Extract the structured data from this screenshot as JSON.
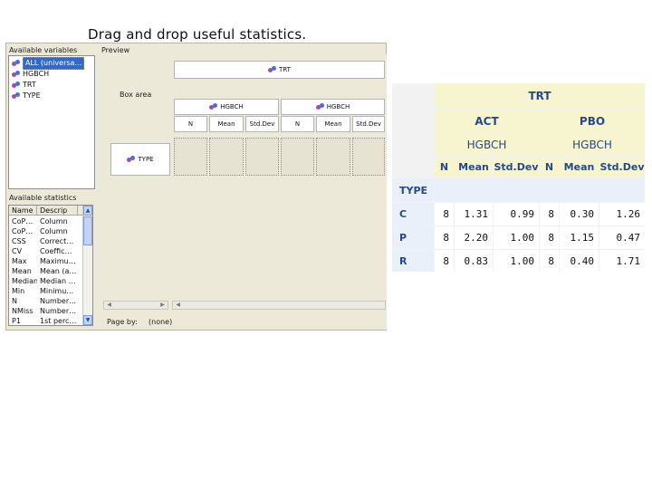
{
  "slide_title": "Drag and drop useful statistics.",
  "dialog": {
    "variables_label": "Available variables",
    "variables": [
      {
        "label": "ALL (universa…",
        "selected": true
      },
      {
        "label": "HGBCH",
        "selected": false
      },
      {
        "label": "TRT",
        "selected": false
      },
      {
        "label": "TYPE",
        "selected": false
      }
    ],
    "statistics_label": "Available statistics",
    "stat_columns": [
      "Name",
      "Descrip"
    ],
    "statistics": [
      {
        "name": "CoP…",
        "desc": "Column"
      },
      {
        "name": "CoP…",
        "desc": "Column"
      },
      {
        "name": "CSS",
        "desc": "Correct…"
      },
      {
        "name": "CV",
        "desc": "Coeffic…"
      },
      {
        "name": "Max",
        "desc": "Maximu…"
      },
      {
        "name": "Mean",
        "desc": "Mean (a…"
      },
      {
        "name": "Median",
        "desc": "Median …"
      },
      {
        "name": "Min",
        "desc": "Minimu…"
      },
      {
        "name": "N",
        "desc": "Number…"
      },
      {
        "name": "NMiss",
        "desc": "Number…"
      },
      {
        "name": "P1",
        "desc": "1st perc…"
      }
    ],
    "preview_label": "Preview",
    "box_area_label": "Box area",
    "trt_label": "TRT",
    "hgbch_label": "HGBCH",
    "stat_labels": [
      "N",
      "Mean",
      "Std.Dev",
      "N",
      "Mean",
      "Std.Dev"
    ],
    "type_label": "TYPE",
    "page_by_label": "Page by:",
    "page_by_value": "(none)"
  },
  "result_table": {
    "top_header": "TRT",
    "groups": [
      "ACT",
      "PBO"
    ],
    "sub_header": "HGBCH",
    "stat_headers": [
      "N",
      "Mean",
      "Std.Dev",
      "N",
      "Mean",
      "Std.Dev"
    ],
    "row_dim": "TYPE",
    "rows": [
      {
        "label": "C",
        "values": [
          "8",
          "1.31",
          "0.99",
          "8",
          "0.30",
          "1.26"
        ]
      },
      {
        "label": "P",
        "values": [
          "8",
          "2.20",
          "1.00",
          "8",
          "1.15",
          "0.47"
        ]
      },
      {
        "label": "R",
        "values": [
          "8",
          "0.83",
          "1.00",
          "8",
          "0.40",
          "1.71"
        ]
      }
    ],
    "colors": {
      "header_bg": "#f7f5cf",
      "header_text": "#244a8d",
      "rowhdr_bg": "#eaf0f9"
    }
  }
}
